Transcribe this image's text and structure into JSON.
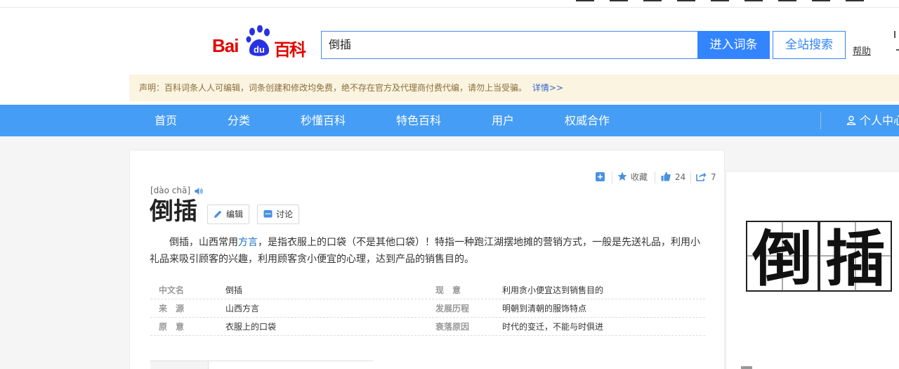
{
  "logo": {
    "bai": "Bai",
    "du": "du",
    "baike": "百科"
  },
  "search": {
    "value": "倒插"
  },
  "header": {
    "enter_label": "进入词条",
    "site_label": "全站搜索",
    "help_label": "帮助"
  },
  "notice": {
    "text": "声明：百科词条人人可编辑，词条创建和修改均免费，绝不存在官方及代理商付费代编，请勿上当受骗。",
    "more": "详情>>"
  },
  "nav": {
    "items": [
      "首页",
      "分类",
      "秒懂百科",
      "特色百科",
      "用户",
      "权威合作"
    ],
    "user_center": "个人中心"
  },
  "toolbar": {
    "favorite_label": "收藏",
    "like_count": "24",
    "share_count": "7"
  },
  "entry": {
    "pinyin": "[dào chā]",
    "title": "倒插",
    "edit_label": "编辑",
    "discuss_label": "讨论",
    "summary_before": "倒插，山西常用",
    "summary_link": "方言",
    "summary_after": "，是指衣服上的口袋（不是其他口袋）！特指一种跑江湖摆地摊的营销方式，一般是先送礼品，利用小礼品来吸引顾客的兴趣，利用顾客贪小便宜的心理，达到产品的销售目的。"
  },
  "info": [
    {
      "k1": "中文名",
      "v1": "倒插",
      "k2": "现　意",
      "v2": "利用贪小便宜达到销售目的"
    },
    {
      "k1": "来　源",
      "v1": "山西方言",
      "k2": "发展历程",
      "v2": "明朝到清朝的服饰特点"
    },
    {
      "k1": "原　意",
      "v1": "衣服上的口袋",
      "k2": "衰落原因",
      "v2": "时代的变迁，不能与时俱进"
    }
  ],
  "side_image": {
    "char1": "倒",
    "char2": "插"
  },
  "colors": {
    "accent": "#3385ff",
    "nav": "#459df5",
    "brand_red": "#e10602",
    "notice_bg": "#faf4e0"
  }
}
